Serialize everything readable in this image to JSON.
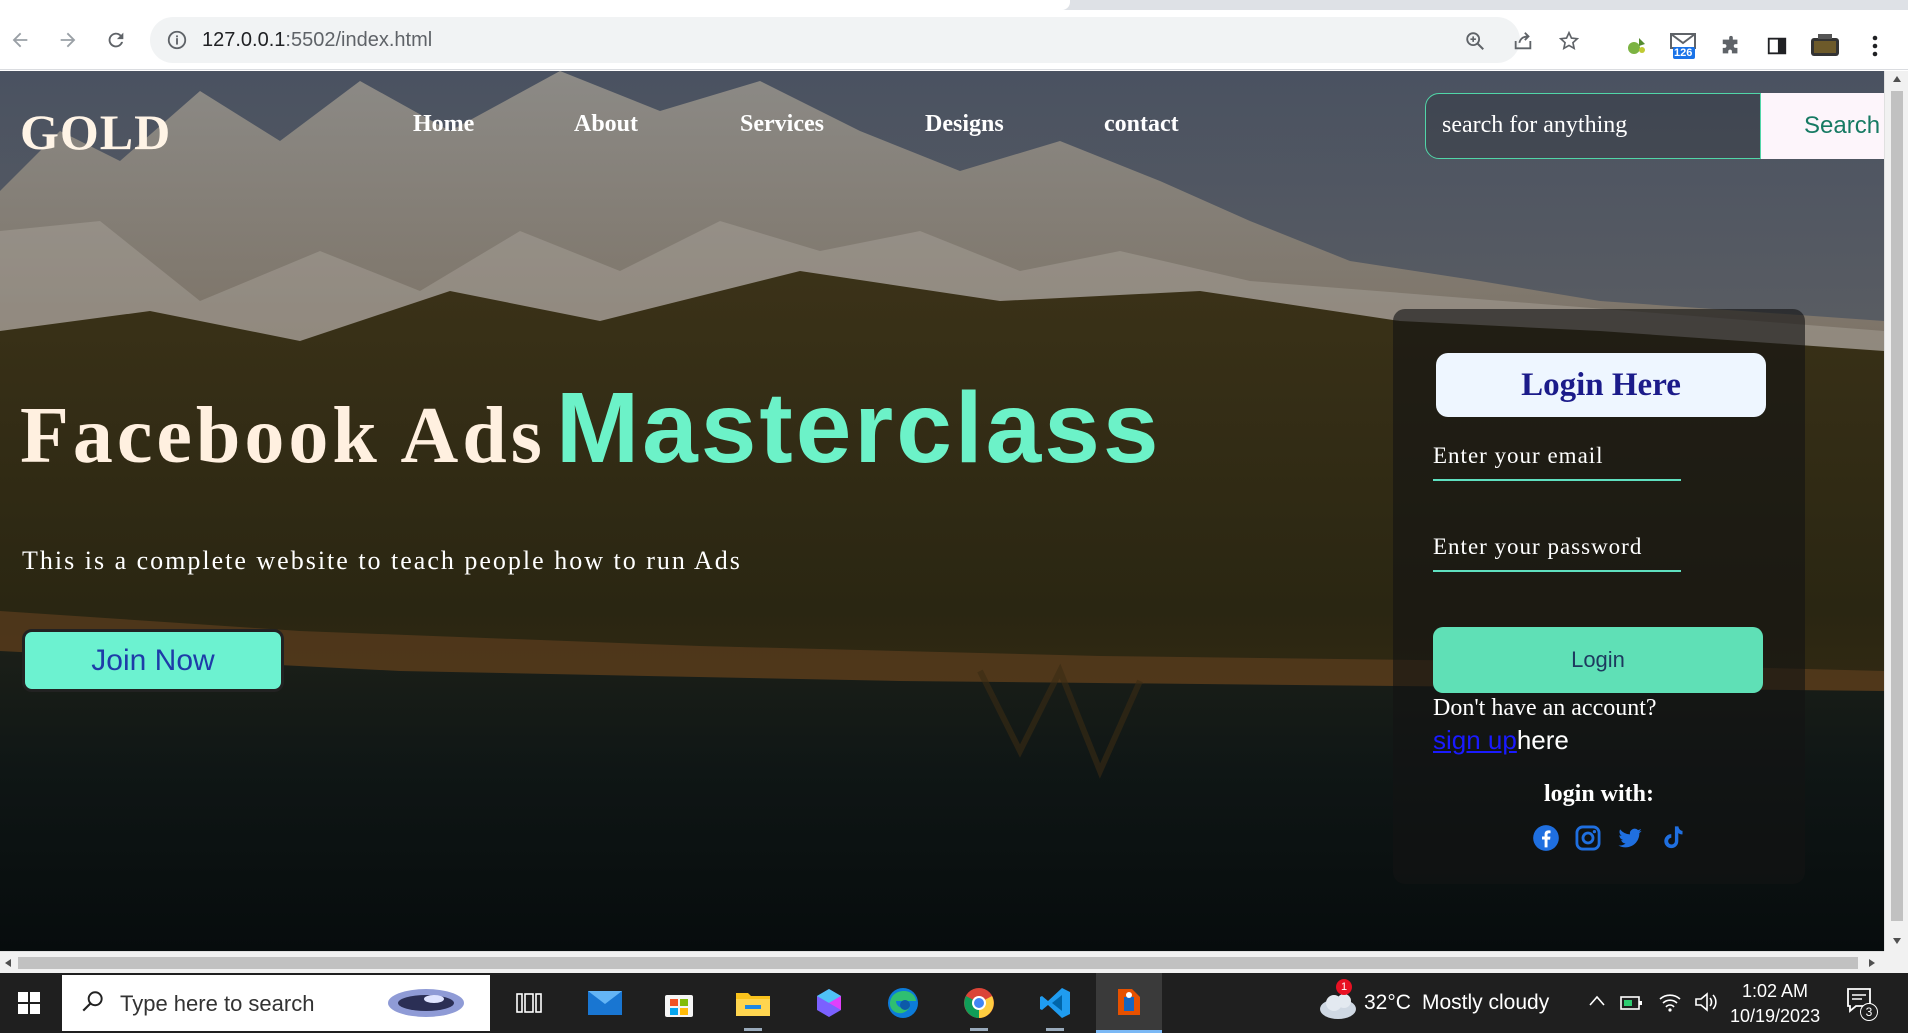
{
  "browser": {
    "url_host": "127.0.0.1",
    "url_rest": ":5502/index.html",
    "mail_badge": "126"
  },
  "site": {
    "logo": "GOLD",
    "nav": [
      "Home",
      "About",
      "Services",
      "Designs",
      "contact"
    ],
    "search_placeholder": "search for anything",
    "search_button": "Search"
  },
  "hero": {
    "title_part1": "Facebook Ads",
    "title_part2": "Masterclass",
    "subtitle": "This is a complete website to teach people how to run Ads",
    "cta": "Join Now"
  },
  "login": {
    "heading": "Login Here",
    "email_placeholder": "Enter your email",
    "password_placeholder": "Enter your password",
    "button": "Login",
    "no_account": "Don't have an account?",
    "signup_link": "sign up",
    "signup_suffix": "here",
    "login_with": "login with:",
    "social_icons": [
      "facebook-icon",
      "instagram-icon",
      "twitter-icon",
      "tiktok-icon"
    ]
  },
  "taskbar": {
    "search_placeholder": "Type here to search",
    "weather_temp": "32°C",
    "weather_desc": "Mostly cloudy",
    "weather_badge": "1",
    "time": "1:02 AM",
    "date": "10/19/2023",
    "notification_count": "3"
  },
  "colors": {
    "accent": "#6cf2c8",
    "join_bg": "#6cf2d0",
    "login_bg": "#5fe0b6",
    "heading_text": "#1b1b8a"
  }
}
